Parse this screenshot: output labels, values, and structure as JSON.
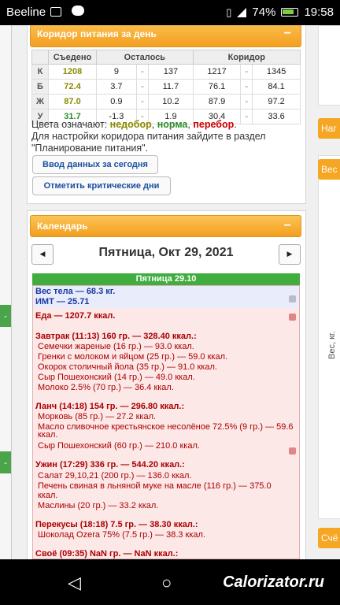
{
  "status": {
    "carrier": "Beeline",
    "battery": "74%",
    "time": "19:58"
  },
  "corridor": {
    "title": "Коридор питания за день",
    "headers": [
      "Съедено",
      "Осталось",
      "Коридор"
    ],
    "rows": [
      {
        "label": "К",
        "eaten": "1208",
        "left_from": "9",
        "left_to": "137",
        "corr_from": "1217",
        "corr_to": "1345"
      },
      {
        "label": "Б",
        "eaten": "72.4",
        "left_from": "3.7",
        "left_to": "11.7",
        "corr_from": "76.1",
        "corr_to": "84.1"
      },
      {
        "label": "Ж",
        "eaten": "87.0",
        "left_from": "0.9",
        "left_to": "10.2",
        "corr_from": "87.9",
        "corr_to": "97.2"
      },
      {
        "label": "У",
        "eaten": "31.7",
        "left_from": "-1.3",
        "left_to": "1.9",
        "corr_from": "30.4",
        "corr_to": "33.6"
      }
    ],
    "dash": "-",
    "legend_prefix": "Цвета означают: ",
    "legend_under": "недобор",
    "legend_sep1": ", ",
    "legend_norm": "норма",
    "legend_sep2": ", ",
    "legend_over": "перебор",
    "legend_end": ".",
    "note": "Для настройки коридора питания зайдите в раздел \"Планирование питания\".",
    "btn_today": "Ввод данных за сегодня",
    "btn_critical": "Отметить критические дни"
  },
  "calendar": {
    "title": "Календарь",
    "date": "Пятница, Окт 29, 2021",
    "day_bar": "Пятница 29.10",
    "weight": "Вес тела — 68.3 кг.",
    "bmi": "ИМТ — 25.71",
    "food": "Еда — 1207.7 ккал.",
    "lines": [
      {
        "text": "Завтрак (11:13) 160 гр. — 328.40 ккал.:",
        "meal": true
      },
      {
        "text": "Семечки жареные (16 гр.) — 93.0 ккал.",
        "meal": false
      },
      {
        "text": "Гренки с молоком и яйцом (25 гр.) — 59.0 ккал.",
        "meal": false
      },
      {
        "text": "Окорок столичный йола (35 гр.) — 91.0 ккал.",
        "meal": false
      },
      {
        "text": "Сыр Пошехонский (14 гр.) — 49.0 ккал.",
        "meal": false
      },
      {
        "text": "Молоко 2.5% (70 гр.) — 36.4 ккал.",
        "meal": false
      },
      {
        "text": "Ланч (14:18) 154 гр. — 296.80 ккал.:",
        "meal": true
      },
      {
        "text": "Морковь (85 гр.) — 27.2 ккал.",
        "meal": false
      },
      {
        "text": "Масло сливочное крестьянское несолёное 72.5% (9 гр.) — 59.6",
        "meal": false
      },
      {
        "text": "ккал.",
        "meal": false
      },
      {
        "text": "Сыр Пошехонский (60 гр.) — 210.0 ккал.",
        "meal": false
      },
      {
        "text": "Ужин (17:29) 336 гр. — 544.20 ккал.:",
        "meal": true
      },
      {
        "text": "Салат 29,10,21 (200 гр.) — 136.0 ккал.",
        "meal": false
      },
      {
        "text": "Печень свиная в льняной муке на масле (116 гр.) — 375.0",
        "meal": false
      },
      {
        "text": "ккал.",
        "meal": false
      },
      {
        "text": "Маслины (20 гр.) — 33.2 ккал.",
        "meal": false
      },
      {
        "text": "Перекусы (18:18) 7.5 гр. — 38.30 ккал.:",
        "meal": true
      },
      {
        "text": "Шоколад Ozera 75% (7.5 гр.) — 38.3 ккал.",
        "meal": false
      },
      {
        "text": "Своё (09:35) NaN гр. — NaN ккал.:",
        "meal": true
      }
    ]
  },
  "right": {
    "tab1": "Наг",
    "tab2": "Вес",
    "axis": "Вес, кг.",
    "tab3": "Счё"
  },
  "side": {
    "tab": "-"
  },
  "navbar": {
    "back": "◁",
    "home": "○",
    "recent": "□",
    "brand": "Calorizator.ru"
  },
  "colors": {
    "accent": "#f39f20",
    "green": "#3fae3f",
    "over": "#cc0000"
  }
}
